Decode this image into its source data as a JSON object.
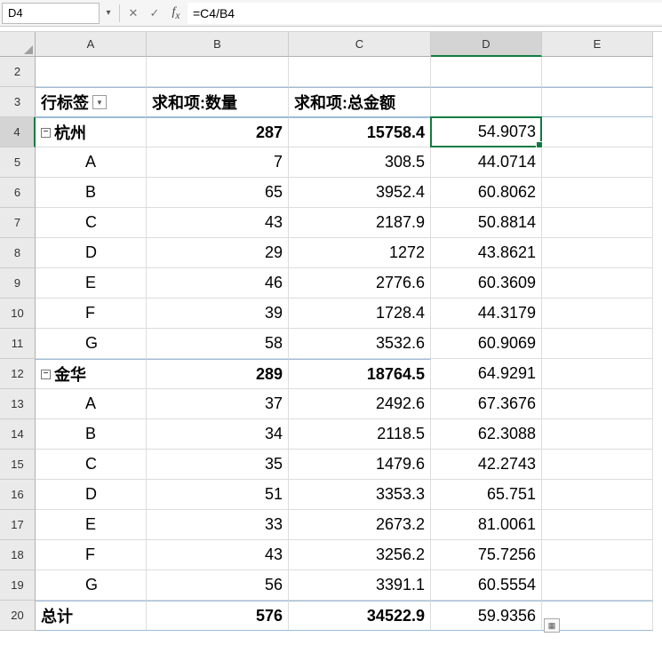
{
  "formula_bar": {
    "name_box": "D4",
    "formula": "=C4/B4"
  },
  "columns": [
    "A",
    "B",
    "C",
    "D",
    "E"
  ],
  "selected_col": "D",
  "selected_row": 4,
  "col_widths": {
    "A": 125,
    "B": 160,
    "C": 160,
    "D": 125,
    "E": 125
  },
  "headers": {
    "row_label": "行标签",
    "sum_qty": "求和项:数量",
    "sum_amount": "求和项:总金额"
  },
  "groups": [
    {
      "name": "杭州",
      "qty": 287,
      "amount": "15758.4",
      "calc": "54.9073",
      "rows": [
        {
          "label": "A",
          "qty": 7,
          "amount": "308.5",
          "calc": "44.0714"
        },
        {
          "label": "B",
          "qty": 65,
          "amount": "3952.4",
          "calc": "60.8062"
        },
        {
          "label": "C",
          "qty": 43,
          "amount": "2187.9",
          "calc": "50.8814"
        },
        {
          "label": "D",
          "qty": 29,
          "amount": "1272",
          "calc": "43.8621"
        },
        {
          "label": "E",
          "qty": 46,
          "amount": "2776.6",
          "calc": "60.3609"
        },
        {
          "label": "F",
          "qty": 39,
          "amount": "1728.4",
          "calc": "44.3179"
        },
        {
          "label": "G",
          "qty": 58,
          "amount": "3532.6",
          "calc": "60.9069"
        }
      ]
    },
    {
      "name": "金华",
      "qty": 289,
      "amount": "18764.5",
      "calc": "64.9291",
      "rows": [
        {
          "label": "A",
          "qty": 37,
          "amount": "2492.6",
          "calc": "67.3676"
        },
        {
          "label": "B",
          "qty": 34,
          "amount": "2118.5",
          "calc": "62.3088"
        },
        {
          "label": "C",
          "qty": 35,
          "amount": "1479.6",
          "calc": "42.2743"
        },
        {
          "label": "D",
          "qty": 51,
          "amount": "3353.3",
          "calc": "65.751"
        },
        {
          "label": "E",
          "qty": 33,
          "amount": "2673.2",
          "calc": "81.0061"
        },
        {
          "label": "F",
          "qty": 43,
          "amount": "3256.2",
          "calc": "75.7256"
        },
        {
          "label": "G",
          "qty": 56,
          "amount": "3391.1",
          "calc": "60.5554"
        }
      ]
    }
  ],
  "total": {
    "label": "总计",
    "qty": 576,
    "amount": "34522.9",
    "calc": "59.9356"
  },
  "visible_row_start": 2,
  "visible_row_end": 20
}
